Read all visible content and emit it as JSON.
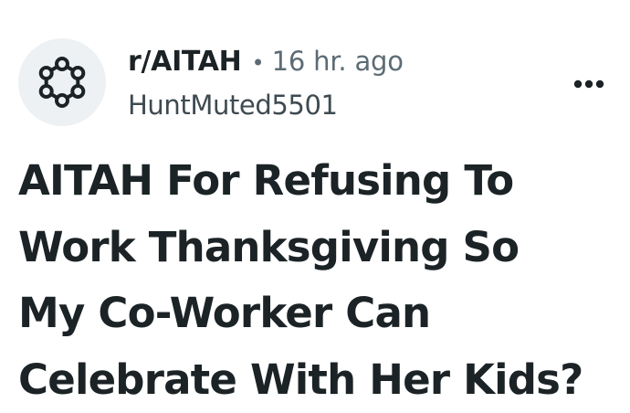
{
  "post": {
    "subreddit": "r/AITAH",
    "separator": "•",
    "time_ago": "16 hr. ago",
    "author": "HuntMuted5501",
    "title_lines": [
      "AITAH For Refusing To",
      "Work Thanksgiving So",
      "My Co-Worker Can",
      "Celebrate With Her Kids?"
    ]
  },
  "icons": {
    "avatar": "subreddit-ring-icon",
    "more": "more-options-icon"
  },
  "colors": {
    "text": "#1c2326",
    "muted": "#5c6c74",
    "avatar_bg": "#eef1f3"
  }
}
